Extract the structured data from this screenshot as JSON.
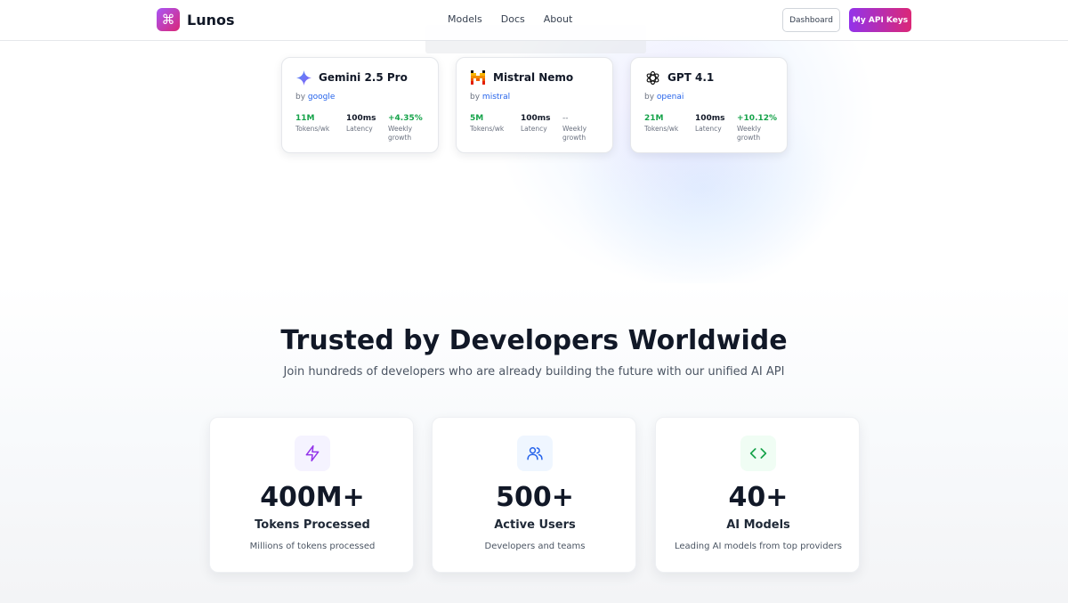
{
  "nav": {
    "brand": "Lunos",
    "links": [
      "Models",
      "Docs",
      "About"
    ],
    "dashboard_label": "Dashboard",
    "api_keys_label": "My API Keys"
  },
  "models": [
    {
      "name": "Gemini 2.5 Pro",
      "by": "by",
      "provider": "google",
      "icon": "gemini-sparkle-icon",
      "tokens": "11M",
      "tokens_label": "Tokens/wk",
      "latency": "100ms",
      "latency_label": "Latency",
      "growth": "+4.35%",
      "growth_label": "Weekly growth"
    },
    {
      "name": "Mistral Nemo",
      "by": "by",
      "provider": "mistral",
      "icon": "mistral-logo-icon",
      "tokens": "5M",
      "tokens_label": "Tokens/wk",
      "latency": "100ms",
      "latency_label": "Latency",
      "growth": "--",
      "growth_label": "Weekly growth"
    },
    {
      "name": "GPT 4.1",
      "by": "by",
      "provider": "openai",
      "icon": "openai-logo-icon",
      "tokens": "21M",
      "tokens_label": "Tokens/wk",
      "latency": "100ms",
      "latency_label": "Latency",
      "growth": "+10.12%",
      "growth_label": "Weekly growth"
    }
  ],
  "trusted": {
    "headline": "Trusted by Developers Worldwide",
    "subline": "Join hundreds of developers who are already building the future with our unified AI API"
  },
  "stats": [
    {
      "value": "400M+",
      "title": "Tokens Processed",
      "desc": "Millions of tokens processed",
      "icon": "lightning-icon",
      "color": "#9333ea"
    },
    {
      "value": "500+",
      "title": "Active Users",
      "desc": "Developers and teams",
      "icon": "users-icon",
      "color": "#2563eb"
    },
    {
      "value": "40+",
      "title": "AI Models",
      "desc": "Leading AI models from top providers",
      "icon": "code-icon",
      "color": "#16a34a"
    }
  ],
  "colors": {
    "accent_start": "#9333ea",
    "accent_end": "#db2777",
    "link_blue": "#2563eb",
    "growth_green": "#16a34a"
  }
}
